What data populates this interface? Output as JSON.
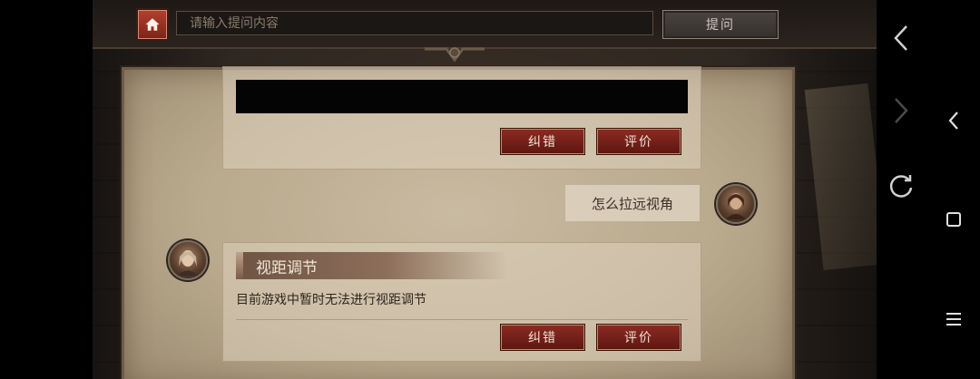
{
  "header": {
    "search_placeholder": "请输入提问内容",
    "ask_label": "提问"
  },
  "previous_answer": {
    "correct_label": "纠错",
    "rate_label": "评价"
  },
  "user_question": "怎么拉远视角",
  "answer": {
    "title": "视距调节",
    "text": "目前游戏中暂时无法进行视距调节",
    "correct_label": "纠错",
    "rate_label": "评价"
  },
  "colors": {
    "accent_red": "#7e2418",
    "parchment": "#c9bba2",
    "dark_wood": "#28221d"
  },
  "icons": {
    "home": "home-icon",
    "back": "chevron-left-icon",
    "forward": "chevron-right-icon",
    "refresh": "refresh-icon",
    "square": "square-icon",
    "menu": "menu-icon"
  }
}
